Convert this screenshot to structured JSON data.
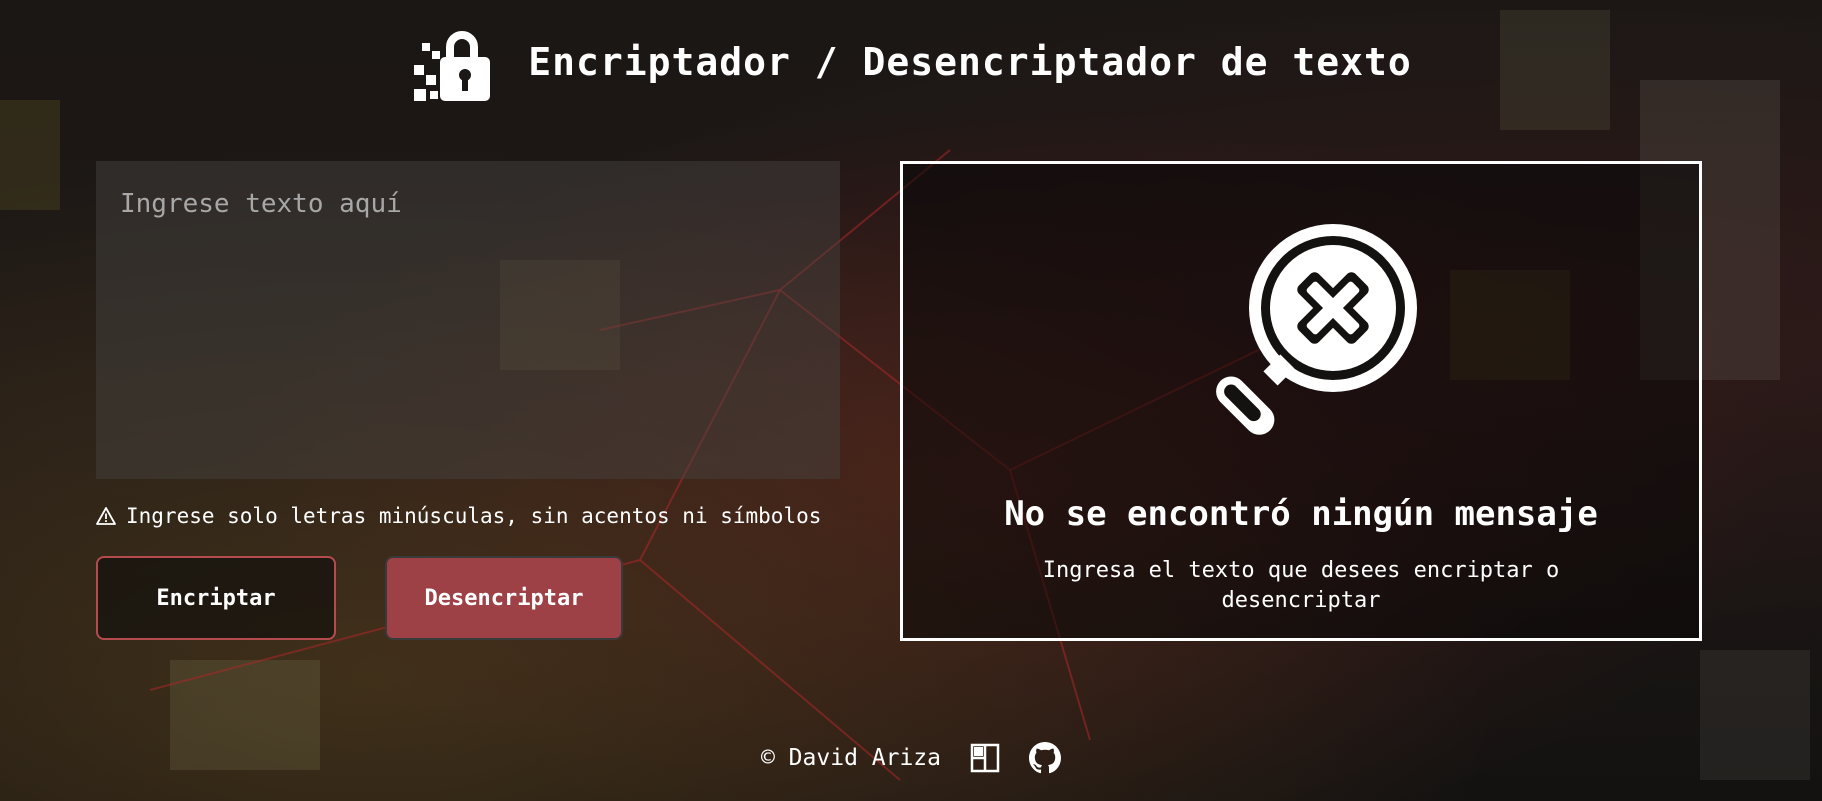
{
  "header": {
    "title": "Encriptador / Desencriptador de texto",
    "logo_icon": "pixel-padlock-icon"
  },
  "input": {
    "placeholder": "Ingrese texto aquí",
    "value": ""
  },
  "warning": {
    "icon": "warning-triangle-icon",
    "text": "Ingrese solo letras minúsculas, sin acentos ni símbolos"
  },
  "buttons": {
    "encrypt_label": "Encriptar",
    "decrypt_label": "Desencriptar"
  },
  "output": {
    "icon": "magnifier-x-icon",
    "title": "No se encontró ningún mensaje",
    "subtitle": "Ingresa el texto que desees encriptar o desencriptar"
  },
  "footer": {
    "copyright": "© David Ariza",
    "links": [
      {
        "icon": "portfolio-icon"
      },
      {
        "icon": "github-icon"
      }
    ]
  },
  "colors": {
    "accent": "#9d4146",
    "accent_border": "#b54a4f",
    "text": "#ffffff",
    "panel_border": "#ffffff"
  }
}
